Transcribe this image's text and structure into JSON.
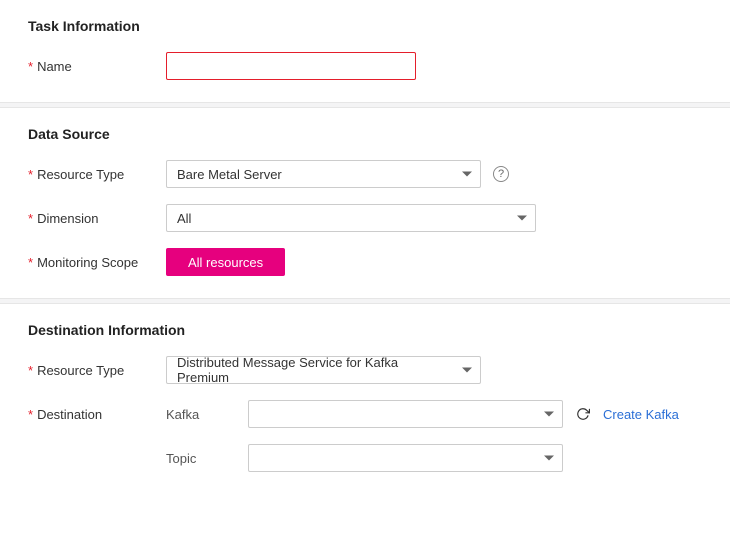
{
  "task_info": {
    "title": "Task Information",
    "name_label": "Name",
    "name_value": ""
  },
  "data_source": {
    "title": "Data Source",
    "resource_type_label": "Resource Type",
    "resource_type_value": "Bare Metal Server",
    "dimension_label": "Dimension",
    "dimension_value": "All",
    "monitoring_scope_label": "Monitoring Scope",
    "monitoring_scope_btn": "All resources"
  },
  "destination": {
    "title": "Destination Information",
    "resource_type_label": "Resource Type",
    "resource_type_value": "Distributed Message Service for Kafka Premium",
    "destination_label": "Destination",
    "kafka_label": "Kafka",
    "kafka_value": "",
    "topic_label": "Topic",
    "topic_value": "",
    "create_link": "Create Kafka"
  }
}
